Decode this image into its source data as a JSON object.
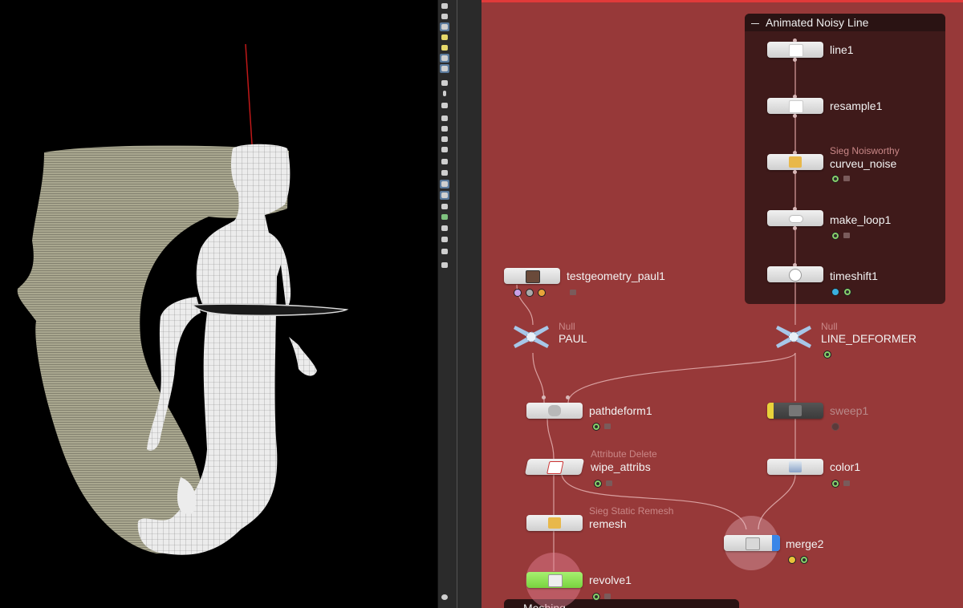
{
  "network": {
    "box": {
      "title": "Animated Noisy Line"
    },
    "bottom_box": {
      "title": "Meshing"
    },
    "nodes": {
      "line1": {
        "name": "line1"
      },
      "resample1": {
        "name": "resample1"
      },
      "curveu_noise": {
        "type": "Sieg Noisworthy",
        "name": "curveu_noise"
      },
      "make_loop1": {
        "name": "make_loop1"
      },
      "timeshift1": {
        "name": "timeshift1"
      },
      "testgeometry_paul1": {
        "name": "testgeometry_paul1"
      },
      "paul": {
        "type": "Null",
        "name": "PAUL"
      },
      "line_deformer": {
        "type": "Null",
        "name": "LINE_DEFORMER"
      },
      "pathdeform1": {
        "name": "pathdeform1"
      },
      "sweep1": {
        "name": "sweep1"
      },
      "wipe_attribs": {
        "type": "Attribute Delete",
        "name": "wipe_attribs"
      },
      "color1": {
        "name": "color1"
      },
      "remesh": {
        "type": "Sieg Static Remesh",
        "name": "remesh"
      },
      "merge2": {
        "name": "merge2"
      },
      "revolve1": {
        "name": "revolve1"
      }
    }
  },
  "viewport": {
    "background": "#000000",
    "surface_color": "#aaa891",
    "mesh_color": "#e8e8e8"
  },
  "colors": {
    "network_bg": "#973939",
    "box_bg": "#3f1a1a",
    "accent_red": "#e23a3a",
    "bypass_yellow": "#e8d23a",
    "display_blue": "#3a86e8",
    "template_green": "#8fe35a"
  }
}
